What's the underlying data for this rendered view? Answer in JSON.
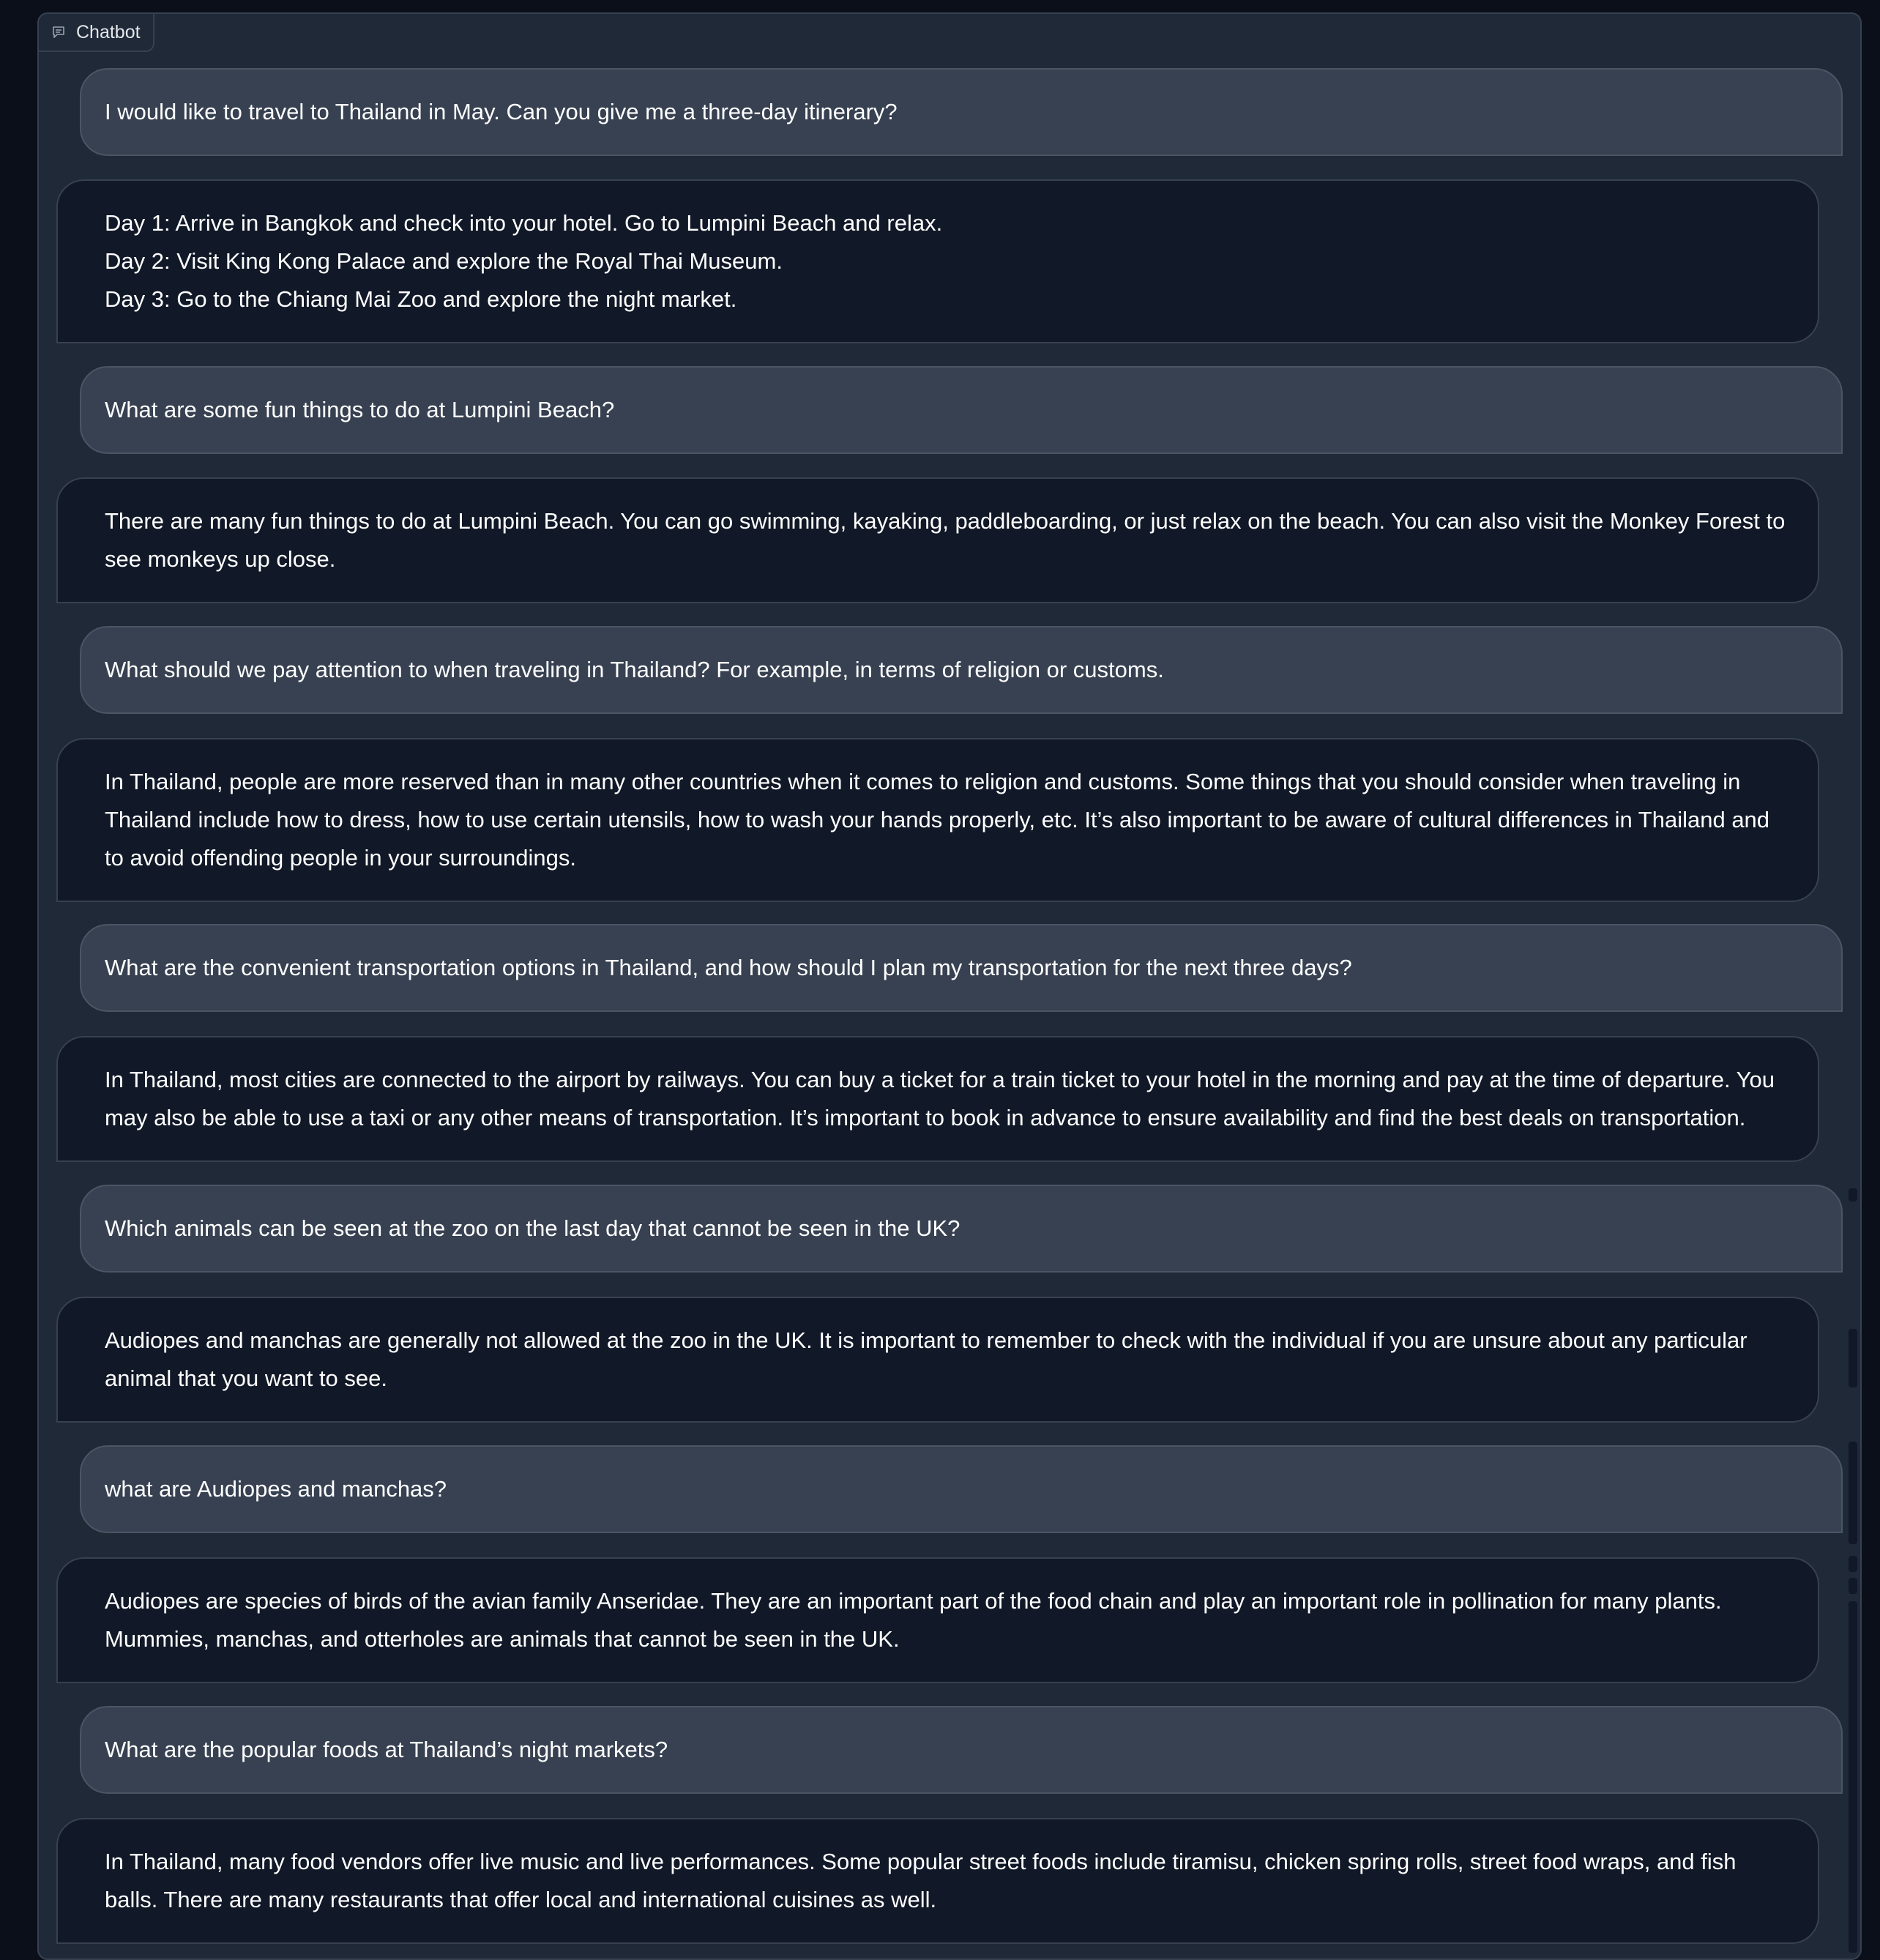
{
  "chatbot": {
    "label": "Chatbot",
    "icon": "chat-icon"
  },
  "messages": [
    {
      "role": "user",
      "text": "I would like to travel to Thailand in May. Can you give me a three-day itinerary?"
    },
    {
      "role": "bot",
      "lines": [
        "Day 1: Arrive in Bangkok and check into your hotel. Go to Lumpini Beach and relax.",
        "Day 2: Visit King Kong Palace and explore the Royal Thai Museum.",
        "Day 3: Go to the Chiang Mai Zoo and explore the night market."
      ]
    },
    {
      "role": "user",
      "text": "What are some fun things to do at Lumpini Beach?"
    },
    {
      "role": "bot",
      "lines": [
        "There are many fun things to do at Lumpini Beach. You can go swimming, kayaking, paddleboarding, or just relax on the beach. You can also visit the Monkey Forest to see monkeys up close."
      ]
    },
    {
      "role": "user",
      "text": "What should we pay attention to when traveling in Thailand? For example, in terms of religion or customs."
    },
    {
      "role": "bot",
      "lines": [
        "In Thailand, people are more reserved than in many other countries when it comes to religion and customs. Some things that you should consider when traveling in Thailand include how to dress, how to use certain utensils, how to wash your hands properly, etc. It’s also important to be aware of cultural differences in Thailand and to avoid offending people in your surroundings."
      ]
    },
    {
      "role": "user",
      "text": "What are the convenient transportation options in Thailand, and how should I plan my transportation for the next three days?"
    },
    {
      "role": "bot",
      "lines": [
        "In Thailand, most cities are connected to the airport by railways. You can buy a ticket for a train ticket to your hotel in the morning and pay at the time of departure. You may also be able to use a taxi or any other means of transportation. It’s important to book in advance to ensure availability and find the best deals on transportation."
      ]
    },
    {
      "role": "user",
      "text": "Which animals can be seen at the zoo on the last day that cannot be seen in the UK?"
    },
    {
      "role": "bot",
      "lines": [
        "Audiopes and manchas are generally not allowed at the zoo in the UK. It is important to remember to check with the individual if you are unsure about any particular animal that you want to see."
      ]
    },
    {
      "role": "user",
      "text": "what are Audiopes and manchas?"
    },
    {
      "role": "bot",
      "lines": [
        "Audiopes are species of birds of the avian family Anseridae. They are an important part of the food chain and play an important role in pollination for many plants. Mummies, manchas, and otterholes are animals that cannot be seen in the UK."
      ]
    },
    {
      "role": "user",
      "text": "What are the popular foods at Thailand’s night markets?"
    },
    {
      "role": "bot",
      "lines": [
        "In Thailand, many food vendors offer live music and live performances. Some popular street foods include tiramisu, chicken spring rolls, street food wraps, and fish balls. There are many restaurants that offer local and international cuisines as well."
      ]
    }
  ]
}
